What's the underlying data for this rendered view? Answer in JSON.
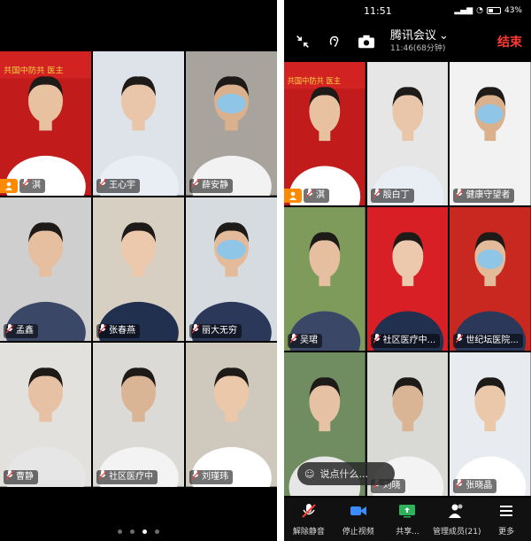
{
  "left_phone": {
    "participants": [
      {
        "name": "淇",
        "host": true,
        "bg": "#c21b1b"
      },
      {
        "name": "王心宇",
        "bg": "#dde3e8"
      },
      {
        "name": "薛安静",
        "bg": "#a9a39e"
      },
      {
        "name": "孟鑫",
        "bg": "#cfcfcf"
      },
      {
        "name": "张春燕",
        "bg": "#d8cfc3"
      },
      {
        "name": "丽大无穷",
        "bg": "#d6dbe0"
      },
      {
        "name": "曹静",
        "bg": "#e3e1de"
      },
      {
        "name": "社区医疗中",
        "bg": "#dcdad6"
      },
      {
        "name": "刘瑾玮",
        "bg": "#cfc8bd"
      }
    ],
    "banner_text": "共国中防共 医主",
    "page_count": 4,
    "active_page": 2
  },
  "right_phone": {
    "status": {
      "time": "11:51",
      "battery": "43%"
    },
    "meeting": {
      "title": "腾讯会议",
      "subtitle": "11:46(68分钟)",
      "end_label": "结束"
    },
    "participants": [
      {
        "name": "淇",
        "host": true,
        "bg": "#c21b1b"
      },
      {
        "name": "殷白丁",
        "bg": "#e6e6e6"
      },
      {
        "name": "健康守望者",
        "bg": "#f2f2f2"
      },
      {
        "name": "吴珺",
        "bg": "#7f9b5c"
      },
      {
        "name": "社区医疗中...",
        "bg": "#d81f26"
      },
      {
        "name": "世纪坛医院...",
        "bg": "#c8281f"
      },
      {
        "name": "",
        "bg": "#6f8d60"
      },
      {
        "name": "刘晓",
        "bg": "#d9d9d5"
      },
      {
        "name": "张晓晶",
        "bg": "#e8ebef"
      }
    ],
    "banner_text": "共国中防共 医主",
    "chat_placeholder": "说点什么...",
    "toolbar": [
      {
        "label": "解除静音",
        "icon": "mic-muted-icon"
      },
      {
        "label": "停止视频",
        "icon": "video-icon"
      },
      {
        "label": "共享...",
        "icon": "share-screen-icon"
      },
      {
        "label": "管理成员(21)",
        "icon": "members-icon"
      },
      {
        "label": "更多",
        "icon": "more-icon"
      }
    ]
  }
}
